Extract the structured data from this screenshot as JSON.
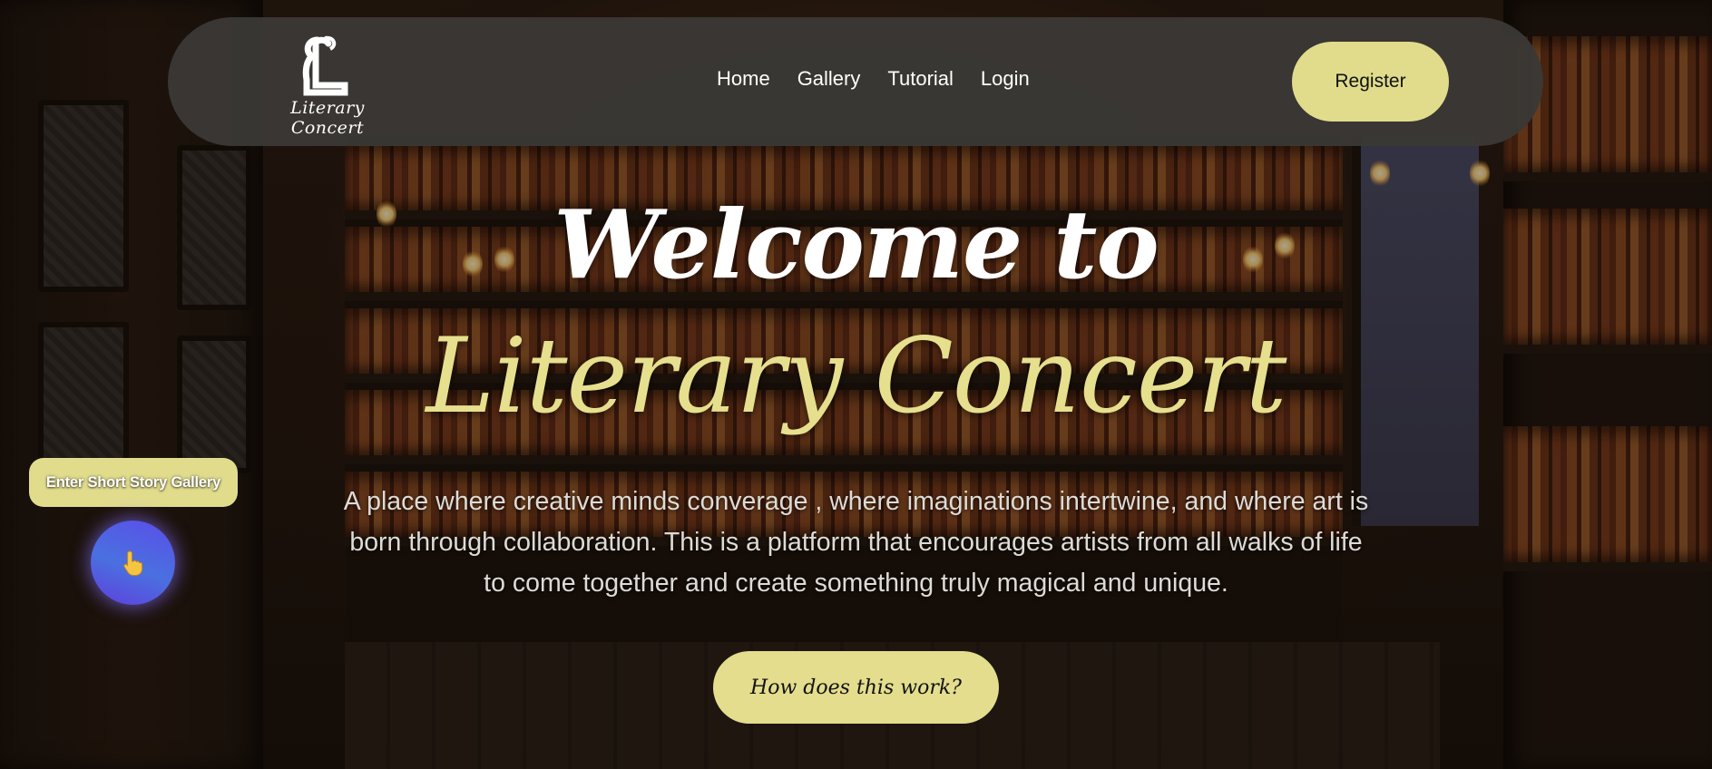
{
  "brand": {
    "logo_mark": "ℒ",
    "logo_text": "Literary Concert"
  },
  "nav": {
    "links": [
      "Home",
      "Gallery",
      "Tutorial",
      "Login"
    ],
    "register_label": "Register"
  },
  "hero": {
    "title_line1": "Welcome to",
    "title_line2": "Literary Concert",
    "description": "A place where creative minds converage , where imaginations intertwine,  and where art is born through collaboration. This is a platform that encourages artists from all walks of life to come together and create something truly magical and unique.",
    "cta_label": "How does this work?"
  },
  "side": {
    "gallery_button_label": "Enter Short Story Gallery",
    "pointer_icon": "pointing-hand-icon"
  },
  "colors": {
    "accent": "#e1dc8c",
    "navbar": "#3a3835",
    "pointer_gradient": [
      "#5a4ee8",
      "#4a70e0"
    ]
  }
}
